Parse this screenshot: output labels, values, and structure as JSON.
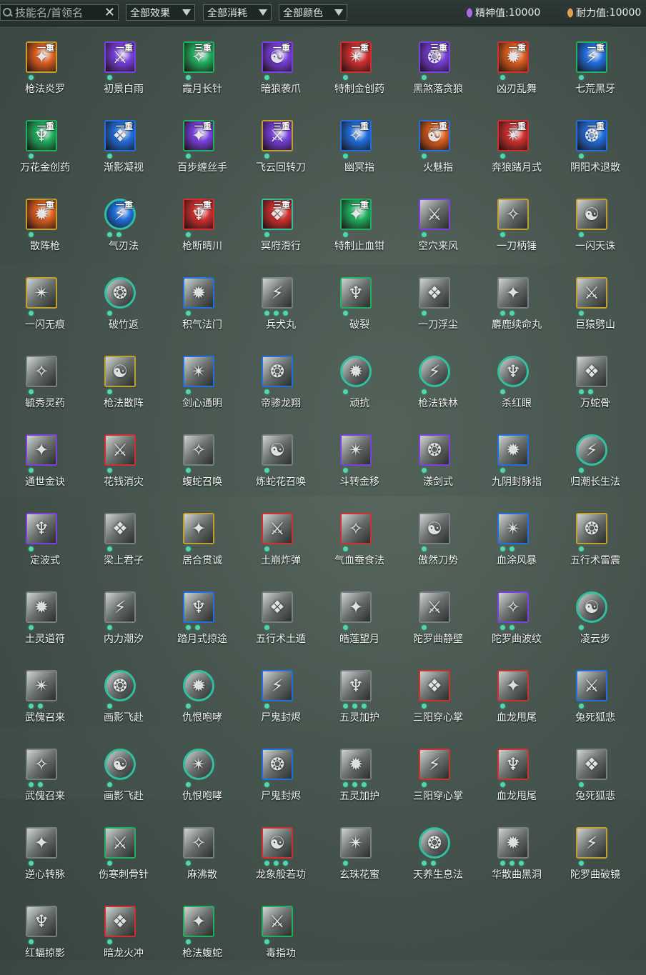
{
  "toolbar": {
    "search_placeholder": "技能名/首领名",
    "clear_label": "✕",
    "filter_effect": "全部效果",
    "filter_cost": "全部消耗",
    "filter_color": "全部颜色",
    "spirit_label": "精神值:",
    "spirit_value": "10000",
    "stamina_label": "耐力值:",
    "stamina_value": "10000"
  },
  "colors": {
    "orange": "#e06020",
    "purple": "#7a40e0",
    "green": "#20b060",
    "blue": "#2070e0",
    "red": "#d03030",
    "gold": "#c0a030",
    "teal": "#30c0a0",
    "gray": "#7a7f86",
    "dot": "#53d6ad"
  },
  "skills": [
    {
      "name": "枪法炎罗",
      "rank": "一重",
      "tone": "orange",
      "border": "gold",
      "dots": 1
    },
    {
      "name": "初景白雨",
      "rank": "一重",
      "tone": "purple",
      "border": "purple",
      "dots": 1
    },
    {
      "name": "霞月长针",
      "rank": "三重",
      "tone": "green",
      "border": "green",
      "dots": 1
    },
    {
      "name": "暗狼袭爪",
      "rank": "一重",
      "tone": "purple",
      "border": "purple",
      "dots": 1
    },
    {
      "name": "特制金创药",
      "rank": "一重",
      "tone": "red",
      "border": "red",
      "dots": 1
    },
    {
      "name": "黑煞落贪狼",
      "rank": "三重",
      "tone": "purple",
      "border": "purple",
      "dots": 1
    },
    {
      "name": "凶刃乱舞",
      "rank": "一重",
      "tone": "orange",
      "border": "red",
      "dots": 1
    },
    {
      "name": "七荒黑牙",
      "rank": "一重",
      "tone": "blue",
      "border": "green",
      "dots": 1
    },
    {
      "name": "万花金创药",
      "rank": "一重",
      "tone": "green",
      "border": "green",
      "dots": 1
    },
    {
      "name": "渐影凝视",
      "rank": "一重",
      "tone": "blue",
      "border": "blue",
      "dots": 1
    },
    {
      "name": "百步缠丝手",
      "rank": "一重",
      "tone": "purple",
      "border": "green",
      "dots": 1
    },
    {
      "name": "飞云回转刀",
      "rank": "三重",
      "tone": "purple",
      "border": "gold",
      "dots": 1
    },
    {
      "name": "幽冥指",
      "rank": "一重",
      "tone": "blue",
      "border": "blue",
      "dots": 1
    },
    {
      "name": "火魅指",
      "rank": "二重",
      "tone": "orange",
      "border": "blue",
      "dots": 1
    },
    {
      "name": "奔狼踏月式",
      "rank": "二重",
      "tone": "red",
      "border": "red",
      "dots": 1
    },
    {
      "name": "阴阳术退散",
      "rank": "一重",
      "tone": "blue",
      "border": "blue",
      "dots": 1
    },
    {
      "name": "散阵枪",
      "rank": "一重",
      "tone": "orange",
      "border": "gold",
      "dots": 1
    },
    {
      "name": "气刃法",
      "rank": "一重",
      "tone": "blue",
      "border": "teal",
      "round": true,
      "dots": 2
    },
    {
      "name": "枪断晴川",
      "rank": "一重",
      "tone": "red",
      "border": "red",
      "dots": 1
    },
    {
      "name": "冥府滑行",
      "rank": "三重",
      "tone": "red",
      "border": "teal",
      "dots": 1
    },
    {
      "name": "特制止血钳",
      "rank": "一重",
      "tone": "green",
      "border": "green",
      "dots": 1
    },
    {
      "name": "空穴来风",
      "rank": "",
      "tone": "gray",
      "border": "purple",
      "dots": 1
    },
    {
      "name": "一刀柄锤",
      "rank": "",
      "tone": "gray",
      "border": "gold",
      "dots": 1
    },
    {
      "name": "一闪天诛",
      "rank": "",
      "tone": "gray",
      "border": "gold",
      "dots": 1
    },
    {
      "name": "一闪无痕",
      "rank": "",
      "tone": "gray",
      "border": "gold",
      "dots": 1
    },
    {
      "name": "破竹返",
      "rank": "",
      "tone": "gray",
      "border": "teal",
      "round": true,
      "dots": 1
    },
    {
      "name": "积气法门",
      "rank": "",
      "tone": "gray",
      "border": "blue",
      "dots": 1
    },
    {
      "name": "兵犬丸",
      "rank": "",
      "tone": "gray",
      "border": "gray",
      "dots": 3
    },
    {
      "name": "破裂",
      "rank": "",
      "tone": "gray",
      "border": "green",
      "dots": 1
    },
    {
      "name": "一刀浮尘",
      "rank": "",
      "tone": "gray",
      "border": "gray",
      "dots": 1
    },
    {
      "name": "麝鹿续命丸",
      "rank": "",
      "tone": "gray",
      "border": "gray",
      "dots": 2
    },
    {
      "name": "巨猿劈山",
      "rank": "",
      "tone": "gray",
      "border": "gold",
      "dots": 1
    },
    {
      "name": "毓秀灵药",
      "rank": "",
      "tone": "gray",
      "border": "gray",
      "dots": 1
    },
    {
      "name": "枪法散阵",
      "rank": "",
      "tone": "gray",
      "border": "gold",
      "dots": 1
    },
    {
      "name": "剑心通明",
      "rank": "",
      "tone": "gray",
      "border": "blue",
      "dots": 1
    },
    {
      "name": "帝骖龙翔",
      "rank": "",
      "tone": "gray",
      "border": "blue",
      "dots": 1
    },
    {
      "name": "顽抗",
      "rank": "",
      "tone": "gray",
      "border": "teal",
      "round": true,
      "dots": 1
    },
    {
      "name": "枪法铁林",
      "rank": "",
      "tone": "gray",
      "border": "teal",
      "round": true,
      "dots": 1
    },
    {
      "name": "杀红眼",
      "rank": "",
      "tone": "gray",
      "border": "teal",
      "round": true,
      "dots": 1
    },
    {
      "name": "万蛇骨",
      "rank": "",
      "tone": "gray",
      "border": "gray",
      "dots": 2
    },
    {
      "name": "通世金诀",
      "rank": "",
      "tone": "gray",
      "border": "purple",
      "dots": 1
    },
    {
      "name": "花钱消灾",
      "rank": "",
      "tone": "gray",
      "border": "red",
      "dots": 1
    },
    {
      "name": "蝮蛇召唤",
      "rank": "",
      "tone": "gray",
      "border": "gray",
      "dots": 1
    },
    {
      "name": "炼蛇花召唤",
      "rank": "",
      "tone": "gray",
      "border": "gray",
      "dots": 1
    },
    {
      "name": "斗转金移",
      "rank": "",
      "tone": "gray",
      "border": "purple",
      "dots": 1
    },
    {
      "name": "漾剑式",
      "rank": "",
      "tone": "gray",
      "border": "purple",
      "dots": 1
    },
    {
      "name": "九阴封脉指",
      "rank": "",
      "tone": "gray",
      "border": "blue",
      "dots": 1
    },
    {
      "name": "归潮长生法",
      "rank": "",
      "tone": "gray",
      "border": "teal",
      "round": true,
      "dots": 1
    },
    {
      "name": "定波式",
      "rank": "",
      "tone": "gray",
      "border": "purple",
      "dots": 1
    },
    {
      "name": "梁上君子",
      "rank": "",
      "tone": "gray",
      "border": "gray",
      "dots": 1
    },
    {
      "name": "居合贯诚",
      "rank": "",
      "tone": "gray",
      "border": "gold",
      "dots": 1
    },
    {
      "name": "土崩炸弹",
      "rank": "",
      "tone": "gray",
      "border": "red",
      "dots": 1
    },
    {
      "name": "气血蚕食法",
      "rank": "",
      "tone": "gray",
      "border": "red",
      "dots": 1
    },
    {
      "name": "傲然刀势",
      "rank": "",
      "tone": "gray",
      "border": "gray",
      "dots": 1
    },
    {
      "name": "血涂风暴",
      "rank": "",
      "tone": "gray",
      "border": "blue",
      "dots": 2
    },
    {
      "name": "五行术雷震",
      "rank": "",
      "tone": "gray",
      "border": "gold",
      "dots": 1
    },
    {
      "name": "土灵道符",
      "rank": "",
      "tone": "gray",
      "border": "gray",
      "dots": 1
    },
    {
      "name": "内力潮汐",
      "rank": "",
      "tone": "gray",
      "border": "gray",
      "dots": 1
    },
    {
      "name": "踏月式掠途",
      "rank": "",
      "tone": "gray",
      "border": "blue",
      "dots": 2
    },
    {
      "name": "五行术土遁",
      "rank": "",
      "tone": "gray",
      "border": "gray",
      "dots": 1
    },
    {
      "name": "皓莲望月",
      "rank": "",
      "tone": "gray",
      "border": "gray",
      "dots": 1
    },
    {
      "name": "陀罗曲静壁",
      "rank": "",
      "tone": "gray",
      "border": "gray",
      "dots": 1
    },
    {
      "name": "陀罗曲波纹",
      "rank": "",
      "tone": "gray",
      "border": "purple",
      "dots": 2
    },
    {
      "name": "凌云步",
      "rank": "",
      "tone": "gray",
      "border": "teal",
      "round": true,
      "dots": 1
    },
    {
      "name": "武傀召来",
      "rank": "",
      "tone": "gray",
      "border": "gray",
      "dots": 2
    },
    {
      "name": "画影飞赴",
      "rank": "",
      "tone": "gray",
      "border": "teal",
      "round": true,
      "dots": 1
    },
    {
      "name": "仇恨咆哮",
      "rank": "",
      "tone": "gray",
      "border": "teal",
      "round": true,
      "dots": 1
    },
    {
      "name": "尸鬼封烬",
      "rank": "",
      "tone": "gray",
      "border": "blue",
      "dots": 1
    },
    {
      "name": "五灵加护",
      "rank": "",
      "tone": "gray",
      "border": "gray",
      "dots": 3
    },
    {
      "name": "三阳穿心掌",
      "rank": "",
      "tone": "gray",
      "border": "red",
      "dots": 1
    },
    {
      "name": "血龙甩尾",
      "rank": "",
      "tone": "gray",
      "border": "red",
      "dots": 1
    },
    {
      "name": "兔死狐悲",
      "rank": "",
      "tone": "gray",
      "border": "blue",
      "dots": 1
    },
    {
      "name": "武傀召来",
      "rank": "",
      "tone": "gray",
      "border": "gray",
      "dots": 2
    },
    {
      "name": "画影飞赴",
      "rank": "",
      "tone": "gray",
      "border": "teal",
      "round": true,
      "dots": 1
    },
    {
      "name": "仇恨咆哮",
      "rank": "",
      "tone": "gray",
      "border": "teal",
      "round": true,
      "dots": 1
    },
    {
      "name": "尸鬼封烬",
      "rank": "",
      "tone": "gray",
      "border": "blue",
      "dots": 1
    },
    {
      "name": "五灵加护",
      "rank": "",
      "tone": "gray",
      "border": "gray",
      "dots": 3
    },
    {
      "name": "三阳穿心掌",
      "rank": "",
      "tone": "gray",
      "border": "red",
      "dots": 1
    },
    {
      "name": "血龙甩尾",
      "rank": "",
      "tone": "gray",
      "border": "red",
      "dots": 1
    },
    {
      "name": "兔死狐悲",
      "rank": "",
      "tone": "gray",
      "border": "gray",
      "dots": 1
    },
    {
      "name": "逆心转脉",
      "rank": "",
      "tone": "gray",
      "border": "gray",
      "dots": 1
    },
    {
      "name": "伤寒刺骨针",
      "rank": "",
      "tone": "gray",
      "border": "green",
      "dots": 1
    },
    {
      "name": "麻沸散",
      "rank": "",
      "tone": "gray",
      "border": "gray",
      "dots": 1
    },
    {
      "name": "龙象般若功",
      "rank": "",
      "tone": "gray",
      "border": "red",
      "dots": 3
    },
    {
      "name": "玄珠花蜜",
      "rank": "",
      "tone": "gray",
      "border": "gray",
      "dots": 1
    },
    {
      "name": "天养生息法",
      "rank": "",
      "tone": "gray",
      "border": "teal",
      "round": true,
      "dots": 2
    },
    {
      "name": "华散曲黑洞",
      "rank": "",
      "tone": "gray",
      "border": "gray",
      "dots": 3
    },
    {
      "name": "陀罗曲破镜",
      "rank": "",
      "tone": "gray",
      "border": "gold",
      "dots": 1
    },
    {
      "name": "红蝠掠影",
      "rank": "",
      "tone": "gray",
      "border": "gray",
      "dots": 1
    },
    {
      "name": "暗龙火冲",
      "rank": "",
      "tone": "gray",
      "border": "red",
      "dots": 1
    },
    {
      "name": "枪法蝮蛇",
      "rank": "",
      "tone": "gray",
      "border": "green",
      "dots": 1
    },
    {
      "name": "毒指功",
      "rank": "",
      "tone": "gray",
      "border": "green",
      "dots": 1
    }
  ]
}
